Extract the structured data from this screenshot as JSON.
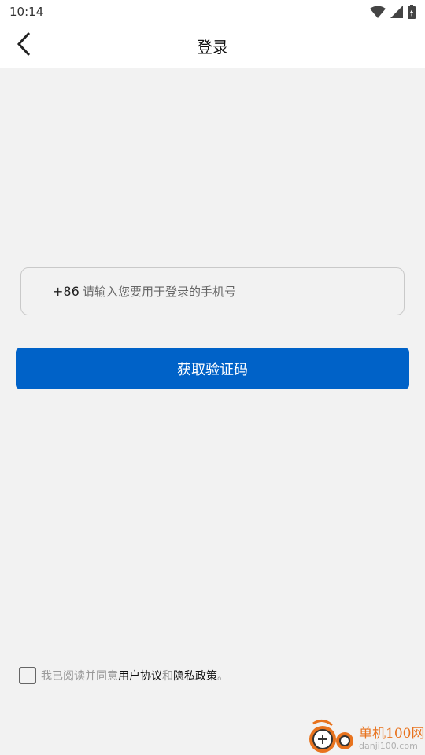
{
  "status_bar": {
    "time": "10:14"
  },
  "header": {
    "title": "登录"
  },
  "login_form": {
    "country_code": "+86",
    "phone_placeholder": "请输入您要用于登录的手机号",
    "phone_value": "",
    "get_code_label": "获取验证码"
  },
  "agreement": {
    "prefix": "我已阅读并同意",
    "user_agreement": "用户协议",
    "and": "和",
    "privacy_policy": "隐私政策",
    "suffix": "。"
  },
  "watermark": {
    "brand": "单机100网",
    "url": "danji100.com"
  },
  "colors": {
    "primary": "#0062c8",
    "background": "#f2f2f2",
    "watermark": "#e8731e"
  }
}
